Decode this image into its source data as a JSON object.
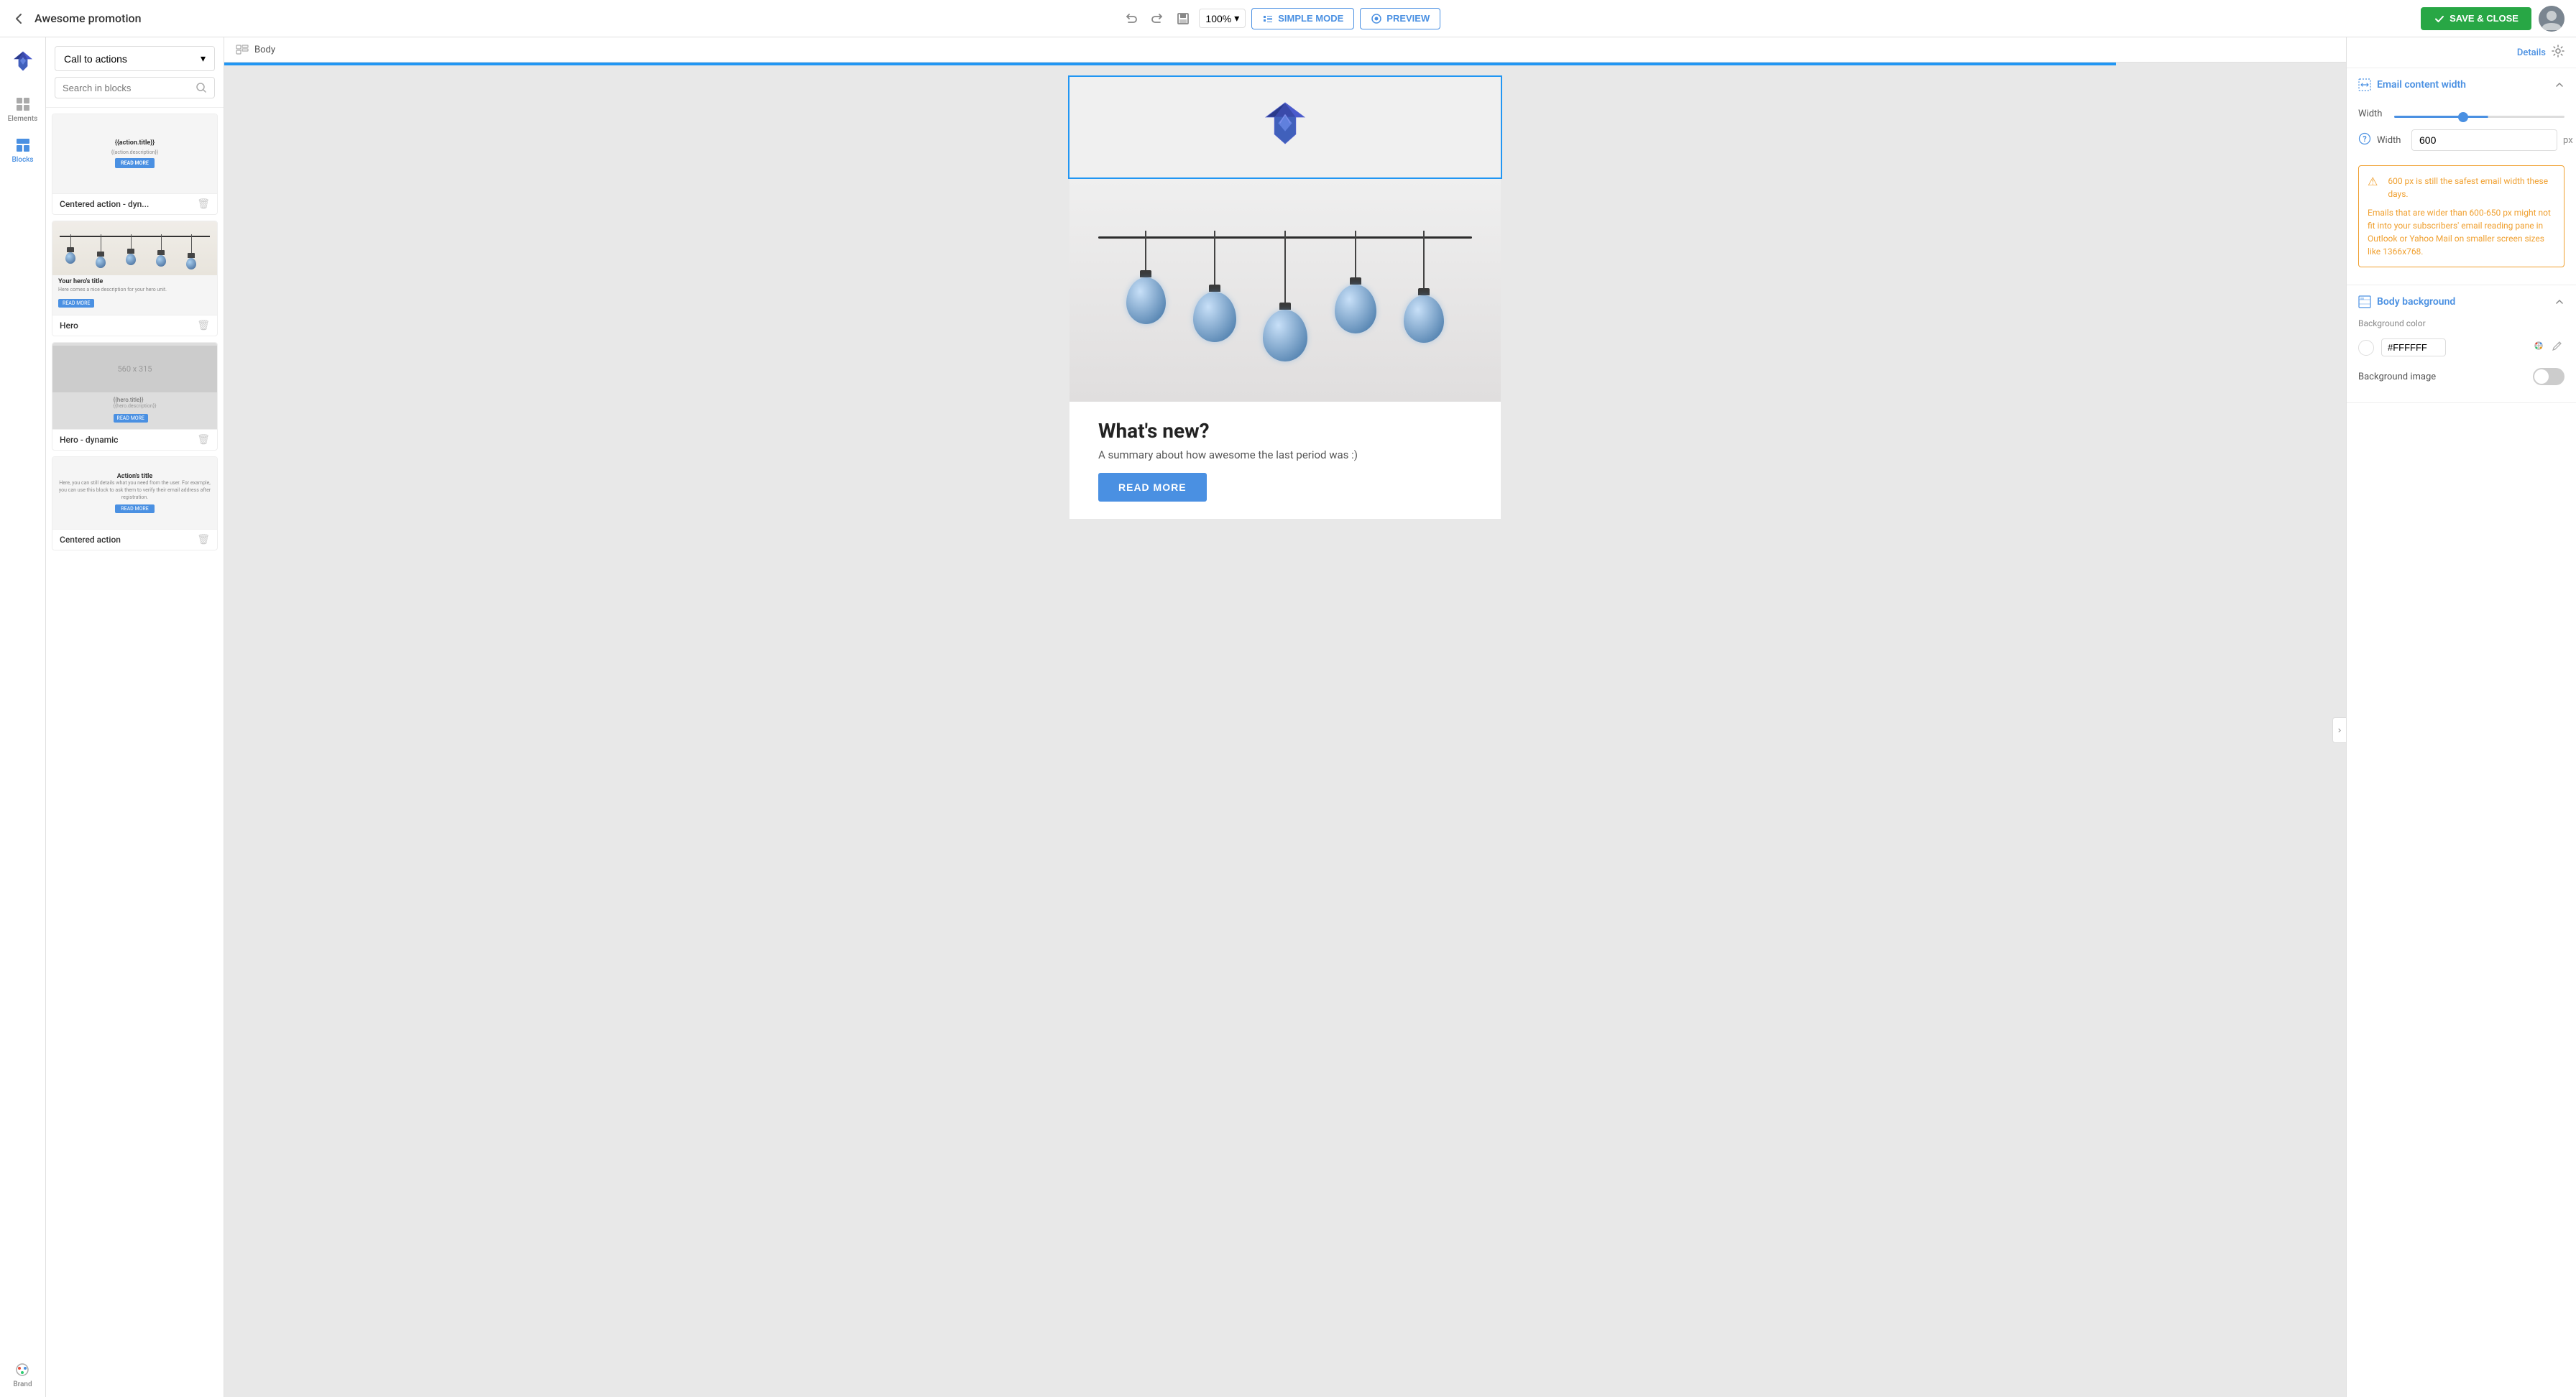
{
  "topbar": {
    "back_icon": "←",
    "title": "Awesome promotion",
    "undo_icon": "↩",
    "redo_icon": "↪",
    "save_draft_icon": "💾",
    "zoom": "100%",
    "zoom_dropdown_icon": "▾",
    "simple_mode_label": "SIMPLE MODE",
    "preview_label": "PREVIEW",
    "save_close_label": "SAVE & CLOSE"
  },
  "left_sidebar": {
    "logo_alt": "Fox logo",
    "items": [
      {
        "id": "elements",
        "label": "Elements",
        "icon": "grid"
      },
      {
        "id": "blocks",
        "label": "Blocks",
        "icon": "blocks",
        "active": true
      }
    ],
    "brand": {
      "label": "Brand",
      "icon": "palette"
    }
  },
  "blocks_panel": {
    "category": "Call to actions",
    "search_placeholder": "Search in blocks",
    "blocks": [
      {
        "id": "centered-action-dyn",
        "name": "Centered action - dyn..."
      },
      {
        "id": "hero",
        "name": "Hero"
      },
      {
        "id": "hero-dynamic",
        "name": "Hero - dynamic"
      },
      {
        "id": "centered-action",
        "name": "Centered action"
      }
    ]
  },
  "canvas": {
    "breadcrumb": "Body",
    "email": {
      "logo_section": "Fox logo",
      "hero_img_alt": "Hanging light bulbs",
      "hero_title": "What's new?",
      "hero_desc": "A summary about how awesome the last period was :)",
      "hero_cta": "READ MORE"
    }
  },
  "right_panel": {
    "details_label": "Details",
    "settings_icon": "⚙",
    "sections": [
      {
        "id": "email-content-width",
        "title": "Email content width",
        "icon": "width",
        "collapsed": false,
        "width_label": "Width",
        "width_value": "600",
        "width_unit": "px",
        "warning": {
          "line1": "600 px is still the safest email width these days.",
          "line2": "Emails that are wider than 600-650 px might not fit into your subscribers' email reading pane in Outlook or Yahoo Mail on smaller screen sizes like 1366x768."
        }
      },
      {
        "id": "body-background",
        "title": "Body background",
        "icon": "image",
        "collapsed": false,
        "bg_color_label": "Background color",
        "bg_color_value": "#FFFFFF",
        "bg_image_label": "Background image",
        "bg_image_enabled": false
      }
    ]
  }
}
